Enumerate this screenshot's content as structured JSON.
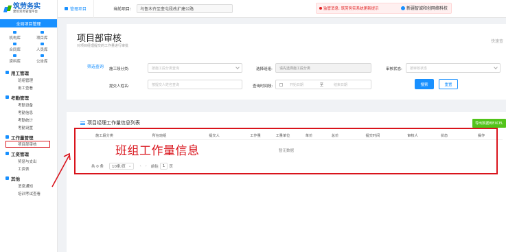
{
  "sidebar": {
    "logo_title": "筑劳务实",
    "logo_subtitle": "建筑劳务管理平台",
    "project_button": "全局项目管理",
    "grid_items": [
      "机构库",
      "项目库",
      "合同库",
      "人员库",
      "资料库",
      "公告库"
    ],
    "sections": [
      {
        "title": "用工管理",
        "items": [
          "班组管理",
          "用工查看"
        ]
      },
      {
        "title": "考勤管理",
        "items": [
          "考勤设备",
          "考勤信息",
          "考勤统计",
          "考勤设置"
        ]
      },
      {
        "title": "工作量管理",
        "items": [
          "项目部审核"
        ]
      },
      {
        "title": "工资管理",
        "items": [
          "奖惩与支出",
          "工资表"
        ]
      },
      {
        "title": "其他",
        "items": [
          "消息通知",
          "培训考试查看"
        ]
      }
    ]
  },
  "topbar": {
    "tab": "管理项目",
    "current_project_label": "当前项目:",
    "current_project_value": "乌鲁木齐至奎屯段改扩建公路",
    "notice": "监管消息: 筑劳务实系统更新提示",
    "user": "新疆智诚和创网络科技"
  },
  "page": {
    "title": "项目部审核",
    "subtitle": "对项目经理提交的工作量进行审批",
    "quick_search": "快速查",
    "filter_label": "筛选查询"
  },
  "form": {
    "section_label": "施工段分类:",
    "section_placeholder": "按施工段分类查询",
    "team_label": "选择班组:",
    "team_placeholder": "请先选择施工段分类",
    "status_label": "审核状态:",
    "status_placeholder": "按审核状态",
    "submitter_label": "提交人姓名:",
    "submitter_placeholder": "按提交人姓名查询",
    "time_label": "查询时间段:",
    "start_placeholder": "开始日期",
    "to": "至",
    "end_placeholder": "结束日期",
    "search_btn": "搜索",
    "reset_btn": "重置"
  },
  "list": {
    "title": "项目经理工作量信息列表",
    "export_btn": "导出数据到EXCEL",
    "columns": [
      "施工段分类",
      "所在班组",
      "提交人",
      "工作量",
      "工量单位",
      "单价",
      "总价",
      "提交时间",
      "审核人",
      "状态",
      "操作"
    ],
    "empty_text": "暂无数据",
    "total": "共 0 条",
    "page_size": "10条/页",
    "goto_label": "前往",
    "goto_page": "1",
    "page_unit": "页"
  },
  "annotation": {
    "text": "班组工作量信息"
  }
}
